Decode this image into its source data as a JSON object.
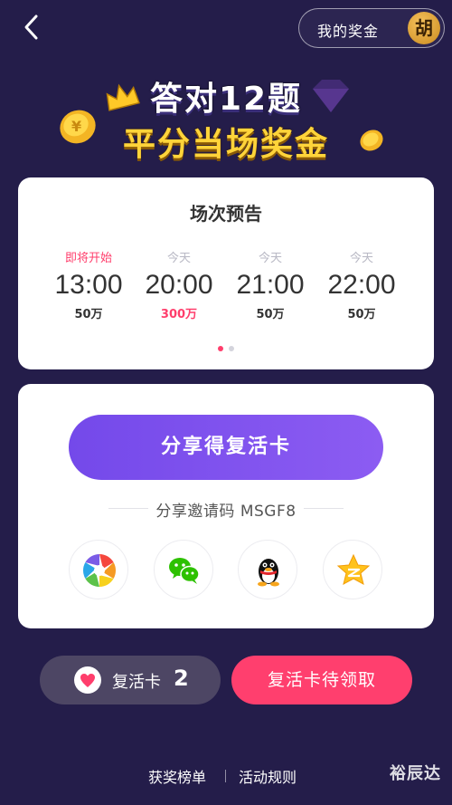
{
  "header": {
    "my_bonus_label": "我的奖金",
    "avatar_char": "胡"
  },
  "hero": {
    "line1": "答对12题",
    "line2": "平分当场奖金"
  },
  "schedule": {
    "title": "场次预告",
    "slots": [
      {
        "status": "即将开始",
        "time": "13:00",
        "prize": "50万"
      },
      {
        "status": "今天",
        "time": "20:00",
        "prize": "300万"
      },
      {
        "status": "今天",
        "time": "21:00",
        "prize": "50万"
      },
      {
        "status": "今天",
        "time": "22:00",
        "prize": "50万"
      }
    ]
  },
  "share": {
    "button_label": "分享得复活卡",
    "invite_text": "分享邀请码 MSGF8",
    "targets": [
      "moments-icon",
      "wechat-icon",
      "qq-icon",
      "qzone-icon"
    ]
  },
  "revive": {
    "label": "复活卡",
    "count": "2",
    "claim_label": "复活卡待领取"
  },
  "footer": {
    "leaderboard": "获奖榜单",
    "rules": "活动规则"
  },
  "watermark": "裕辰达",
  "colors": {
    "background": "#241d4a",
    "accent_pink": "#ff3e6c",
    "accent_purple": "#7449ea",
    "gold": "#ffd43a"
  }
}
